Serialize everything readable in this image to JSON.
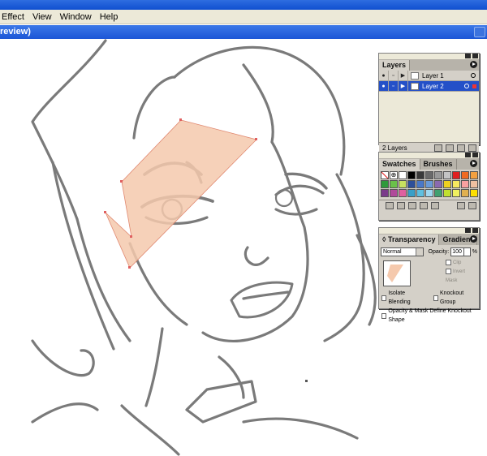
{
  "menubar": [
    "Effect",
    "View",
    "Window",
    "Help"
  ],
  "doc_title": "review)",
  "layers": {
    "tab": "Layers",
    "rows": [
      {
        "name": "Layer 1",
        "selected": false
      },
      {
        "name": "Layer 2",
        "selected": true
      }
    ],
    "footer": "2 Layers"
  },
  "swatches": {
    "tabs": [
      "Swatches",
      "Brushes"
    ],
    "colors": [
      "#ffffff",
      "#ffffff",
      "#ffffff",
      "#000000",
      "#3a3a3a",
      "#6a6a6a",
      "#9a9a9a",
      "#c4c4c4",
      "#e02020",
      "#f06a20",
      "#f3a040",
      "#2e9a3a",
      "#6ac04a",
      "#c8e060",
      "#2d4f9a",
      "#4a78c8",
      "#6a9ad8",
      "#8a6ab0",
      "#f0d020",
      "#f6e860",
      "#f9a0a0",
      "#f0c0a0",
      "#7a3a8a",
      "#b04a9a",
      "#e060a0",
      "#3aa0c8",
      "#60c0e0",
      "#a0d8f0",
      "#40a070",
      "#c0e030",
      "#f0f060",
      "#e0b050",
      "#ffe000"
    ]
  },
  "transparency": {
    "tabs": [
      "Transparency",
      "Gradient"
    ],
    "mode": "Normal",
    "opacity_label": "Opacity:",
    "opacity_value": "100",
    "opacity_unit": "%",
    "clip": "Clip",
    "invert_mask": "Invert Mask",
    "isolate_blending": "Isolate Blending",
    "knockout_group": "Knockout Group",
    "opacity_mask_define": "Opacity & Mask Define Knockout Shape",
    "swatch_color": "#f5c9ad"
  }
}
